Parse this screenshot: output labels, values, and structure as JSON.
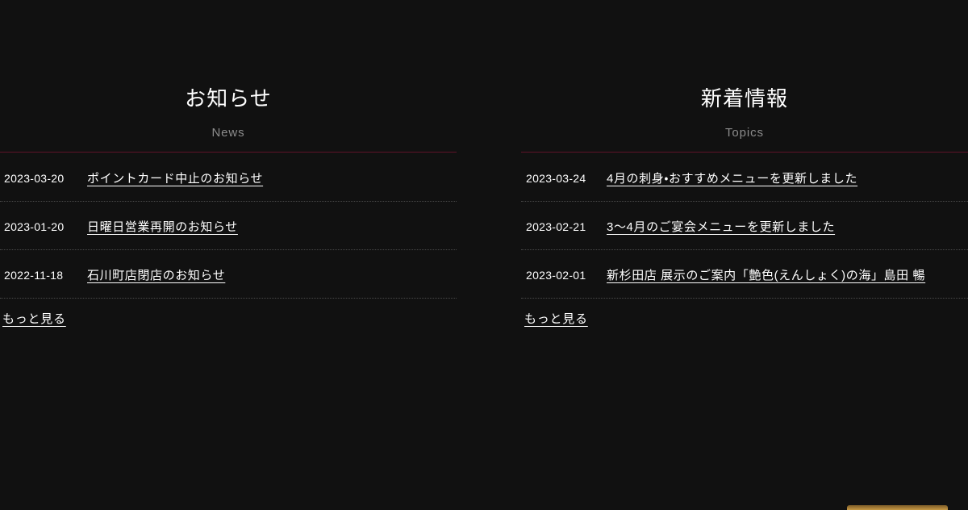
{
  "page": {
    "background_color": "#111111",
    "rule_color": "#5e1229",
    "separator_color": "#4a4a4a",
    "text_color": "#ffffff",
    "muted_text_color": "#8c8c8c"
  },
  "columns": [
    {
      "heading": "お知らせ",
      "subheading": "News",
      "items": [
        {
          "date": "2023-03-20",
          "title": "ポイントカード中止のお知らせ"
        },
        {
          "date": "2023-01-20",
          "title": "日曜日営業再開のお知らせ"
        },
        {
          "date": "2022-11-18",
          "title": "石川町店閉店のお知らせ"
        }
      ],
      "more_label": "もっと見る"
    },
    {
      "heading": "新着情報",
      "subheading": "Topics",
      "items": [
        {
          "date": "2023-03-24",
          "title": "4月の刺身・おすすめメニューを更新しました"
        },
        {
          "date": "2023-02-21",
          "title": "3〜4月のご宴会メニューを更新しました"
        },
        {
          "date": "2023-02-01",
          "title": "新杉田店 展示のご案内「艶色(えんしょく)の海」島田 暢"
        }
      ],
      "more_label": "もっと見る"
    }
  ],
  "corner_banner": {
    "color": "#b98d3f"
  }
}
